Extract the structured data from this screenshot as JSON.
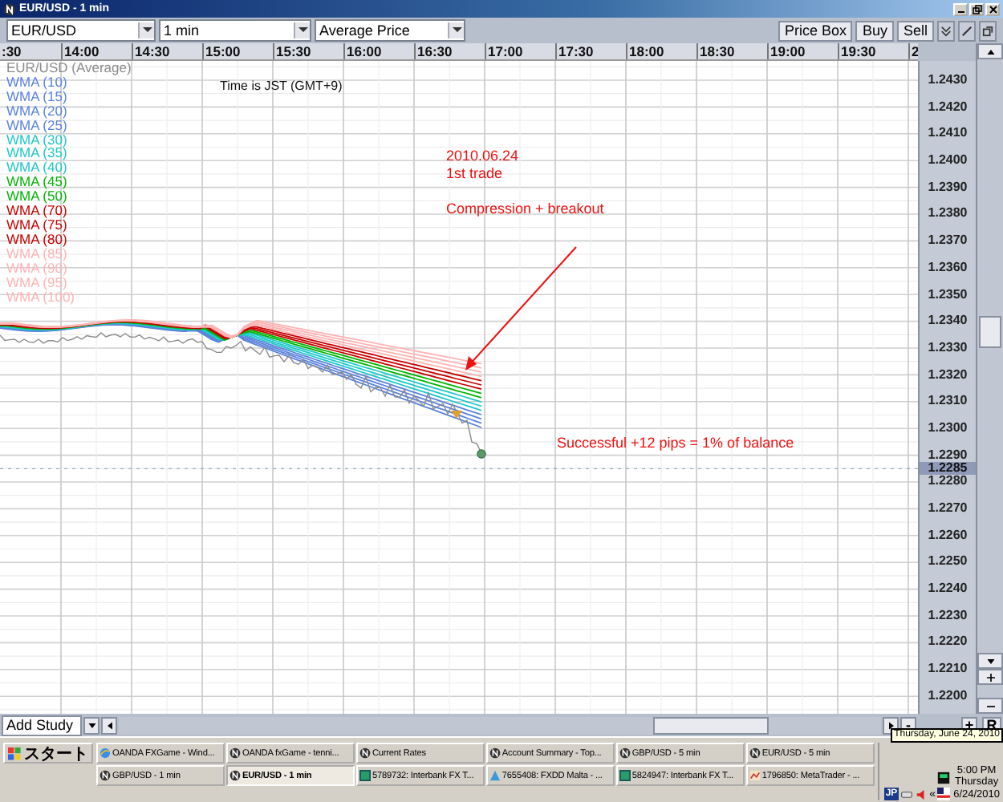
{
  "window": {
    "title": "EUR/USD - 1 min"
  },
  "toolbar": {
    "instrument": "EUR/USD",
    "interval": "1 min",
    "price_type": "Average Price",
    "buttons": [
      "Price Box",
      "Buy",
      "Sell"
    ]
  },
  "time_axis": [
    ":30",
    "14:00",
    "14:30",
    "15:00",
    "15:30",
    "16:00",
    "16:30",
    "17:00",
    "17:30",
    "18:00",
    "18:30",
    "19:00",
    "19:30",
    "2"
  ],
  "legend": [
    {
      "label": "EUR/USD (Average)",
      "color": "#8c8c8c"
    },
    {
      "label": "WMA (10)",
      "color": "#5a82dc"
    },
    {
      "label": "WMA (15)",
      "color": "#5a82dc"
    },
    {
      "label": "WMA (20)",
      "color": "#5a82dc"
    },
    {
      "label": "WMA (25)",
      "color": "#5a82dc"
    },
    {
      "label": "WMA (30)",
      "color": "#1ec8c8"
    },
    {
      "label": "WMA (35)",
      "color": "#1ec8c8"
    },
    {
      "label": "WMA (40)",
      "color": "#1ec8c8"
    },
    {
      "label": "WMA (45)",
      "color": "#00b400"
    },
    {
      "label": "WMA (50)",
      "color": "#00b400"
    },
    {
      "label": "WMA (70)",
      "color": "#c80000"
    },
    {
      "label": "WMA (75)",
      "color": "#c80000"
    },
    {
      "label": "WMA (80)",
      "color": "#c80000"
    },
    {
      "label": "WMA (85)",
      "color": "#ffb4b4"
    },
    {
      "label": "WMA (90)",
      "color": "#ffb4b4"
    },
    {
      "label": "WMA (95)",
      "color": "#ffb4b4"
    },
    {
      "label": "WMA (100)",
      "color": "#ffb4b4"
    }
  ],
  "timezone_note": "Time is JST (GMT+9)",
  "annotations": {
    "date": "2010.06.24",
    "trade": "1st trade",
    "setup": "Compression + breakout",
    "result": "Successful +12 pips = 1% of balance"
  },
  "price_axis": [
    "1.2430",
    "1.2420",
    "1.2410",
    "1.2400",
    "1.2390",
    "1.2380",
    "1.2370",
    "1.2360",
    "1.2350",
    "1.2340",
    "1.2330",
    "1.2320",
    "1.2310",
    "1.2300",
    "1.2290",
    "1.2280",
    "1.2270",
    "1.2260",
    "1.2250",
    "1.2240",
    "1.2230",
    "1.2220",
    "1.2210",
    "1.2200"
  ],
  "current_price": "1.2285",
  "bottom_bar": {
    "study_field": "Add Study",
    "zoom_out": "-",
    "zoom_in": "+",
    "reset": "R"
  },
  "taskbar": {
    "start": "スタート",
    "tasks": [
      {
        "label": "OANDA FXGame - Wind...",
        "kind": "globe",
        "selected": false
      },
      {
        "label": "OANDA fxGame - tenni...",
        "kind": "circle",
        "selected": false
      },
      {
        "label": "Current Rates",
        "kind": "circle",
        "selected": false
      },
      {
        "label": "Account Summary - Top...",
        "kind": "circle",
        "selected": false
      },
      {
        "label": "GBP/USD - 5 min",
        "kind": "circle",
        "selected": false
      },
      {
        "label": "EUR/USD - 5 min",
        "kind": "circle",
        "selected": false
      },
      {
        "label": "GBP/USD - 1 min",
        "kind": "circle",
        "selected": false
      },
      {
        "label": "EUR/USD - 1 min",
        "kind": "circle",
        "selected": true
      },
      {
        "label": "5789732: Interbank FX T...",
        "kind": "square",
        "selected": false
      },
      {
        "label": "7655408: FXDD Malta - ...",
        "kind": "triangle",
        "selected": false
      },
      {
        "label": "5824947: Interbank FX T...",
        "kind": "square",
        "selected": false
      },
      {
        "label": "1796850: MetaTrader - ...",
        "kind": "bars",
        "selected": false
      }
    ],
    "ime": "JP",
    "chevron": "«",
    "clock": {
      "time": "5:00 PM",
      "day": "Thursday",
      "date": "6/24/2010"
    },
    "tooltip": "Thursday, June 24, 2010"
  }
}
